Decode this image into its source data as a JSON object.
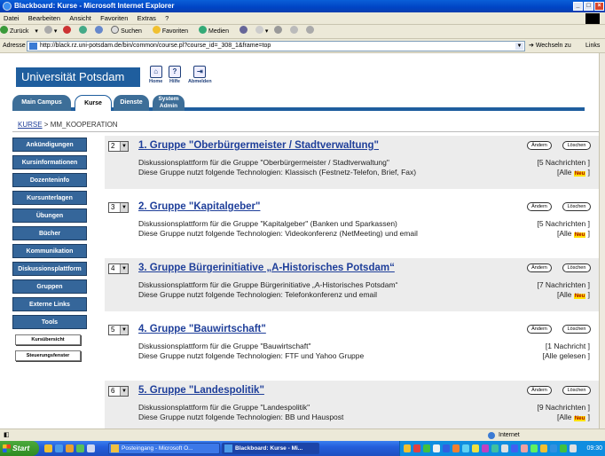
{
  "window": {
    "title": "Blackboard: Kurse - Microsoft Internet Explorer"
  },
  "menu": [
    "Datei",
    "Bearbeiten",
    "Ansicht",
    "Favoriten",
    "Extras",
    "?"
  ],
  "toolbar": {
    "back": "Zurück",
    "search": "Suchen",
    "favorites": "Favoriten",
    "media": "Medien"
  },
  "address": {
    "label": "Adresse",
    "url": "http://black.rz.uni-potsdam.de/bin/common/course.pl?course_id=_308_1&frame=top",
    "go": "Wechseln zu",
    "links": "Links"
  },
  "header": {
    "logo": "Universität Potsdam",
    "icons": [
      {
        "label": "Home",
        "icon": "home-icon"
      },
      {
        "label": "Hilfe",
        "icon": "help-icon"
      },
      {
        "label": "Abmelden",
        "icon": "logout-icon"
      }
    ]
  },
  "tabs": [
    "Main Campus",
    "Kurse",
    "Dienste",
    "System Admin"
  ],
  "breadcrumb": {
    "link": "KURSE",
    "sep": ">",
    "current": "MM_KOOPERATION"
  },
  "nav": [
    "Ankündigungen",
    "Kursinformationen",
    "Dozenteninfo",
    "Kursunterlagen",
    "Übungen",
    "Bücher",
    "Kommunikation",
    "Diskussionsplattform",
    "Gruppen",
    "Externe Links",
    "Tools"
  ],
  "nav_small": [
    "Kursübersicht",
    "Steuerungsfenster"
  ],
  "actions": {
    "edit": "Ändern",
    "delete": "Löschen",
    "all": "[Alle",
    "new": "Neu",
    "close": "]"
  },
  "groups": [
    {
      "order": "2",
      "title": "1. Gruppe \"Oberbürgermeister / Stadtverwaltung\"",
      "desc": "Diskussionsplattform für die Gruppe \"Oberbürgermeister / Stadtverwaltung\"",
      "tech": "Diese Gruppe nutzt folgende Technologien: Klassisch (Festnetz-Telefon, Brief, Fax)",
      "count": "[5 Nachrichten ]",
      "read": "[Alle Neu ]"
    },
    {
      "order": "3",
      "title": "2. Gruppe \"Kapitalgeber\"",
      "desc": "Diskussionsplattform für die Gruppe \"Kapitalgeber\" (Banken und Sparkassen)",
      "tech": "Diese Gruppe nutzt folgende Technologien: Videokonferenz (NetMeeting) und email",
      "count": "[5 Nachrichten ]",
      "read": "[Alle Neu ]"
    },
    {
      "order": "4",
      "title": "3. Gruppe Bürgerinitiative „A-Historisches Potsdam“",
      "desc": "Diskussionsplattform für die Gruppe Bürgerinitiative „A-Historisches Potsdam“",
      "tech": "Diese Gruppe nutzt folgende Technologien: Telefonkonferenz und email",
      "count": "[7 Nachrichten ]",
      "read": "[Alle Neu ]"
    },
    {
      "order": "5",
      "title": "4. Gruppe \"Bauwirtschaft\"",
      "desc": "Diskussionsplattform für die Gruppe \"Bauwirtschaft\"",
      "tech": "Diese Gruppe nutzt folgende Technologien: FTF und Yahoo Gruppe",
      "count": "[1 Nachricht ]",
      "read": "[Alle gelesen ]"
    },
    {
      "order": "6",
      "title": "5. Gruppe \"Landespolitik\"",
      "desc": "Diskussionsplattform für die Gruppe \"Landespolitik\"",
      "tech": "Diese Gruppe nutzt folgende Technologien: BB und Hauspost",
      "count": "[9 Nachrichten ]",
      "read": "[Alle Neu ]"
    }
  ],
  "status": {
    "zone": "Internet"
  },
  "taskbar": {
    "start": "Start",
    "tasks": [
      "Posteingang - Microsoft O...",
      "Blackboard: Kurse - Mi..."
    ],
    "clock": "09:30"
  }
}
